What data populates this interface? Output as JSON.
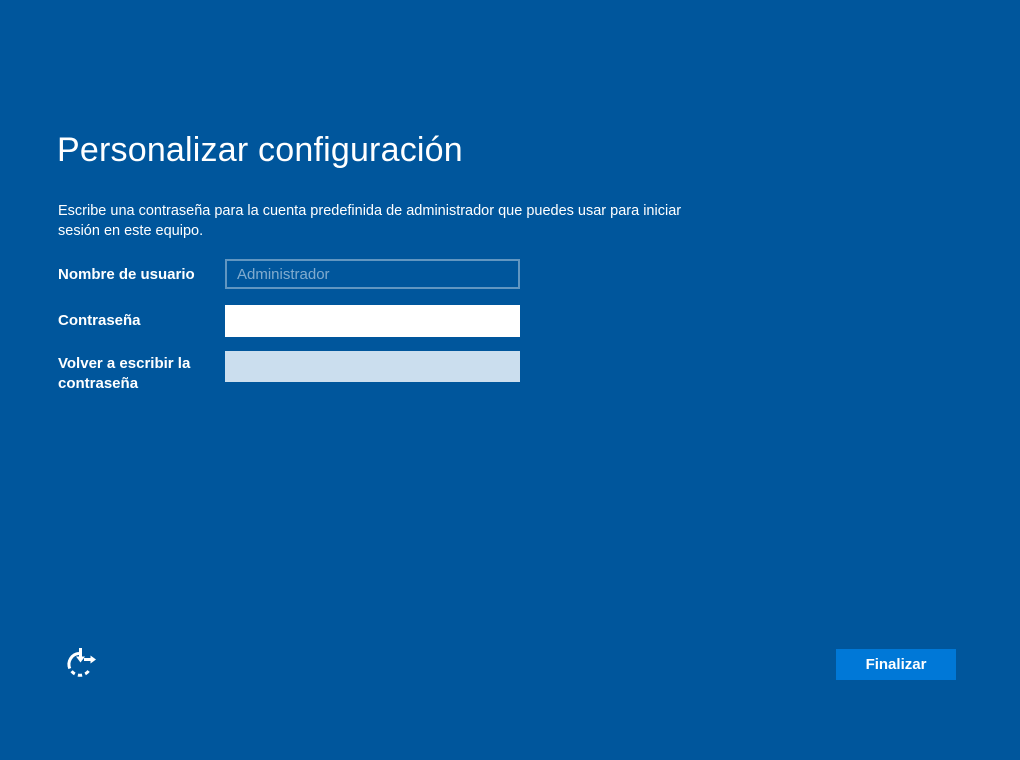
{
  "header": {
    "title": "Personalizar configuración",
    "description": "Escribe una contraseña para la cuenta predefinida de administrador que puedes usar para iniciar sesión en este equipo."
  },
  "form": {
    "username": {
      "label": "Nombre de usuario",
      "placeholder": "Administrador",
      "value": ""
    },
    "password": {
      "label": "Contraseña",
      "value": ""
    },
    "confirm_password": {
      "label": "Volver a escribir la contraseña",
      "value": ""
    }
  },
  "footer": {
    "finish_button_label": "Finalizar",
    "ease_of_access_icon": "ease-of-access-icon"
  },
  "colors": {
    "background": "#00569C",
    "accent_button": "#0078D7",
    "confirm_field_bg": "#CBDEEE",
    "input_border": "rgba(255,255,255,0.38)"
  }
}
